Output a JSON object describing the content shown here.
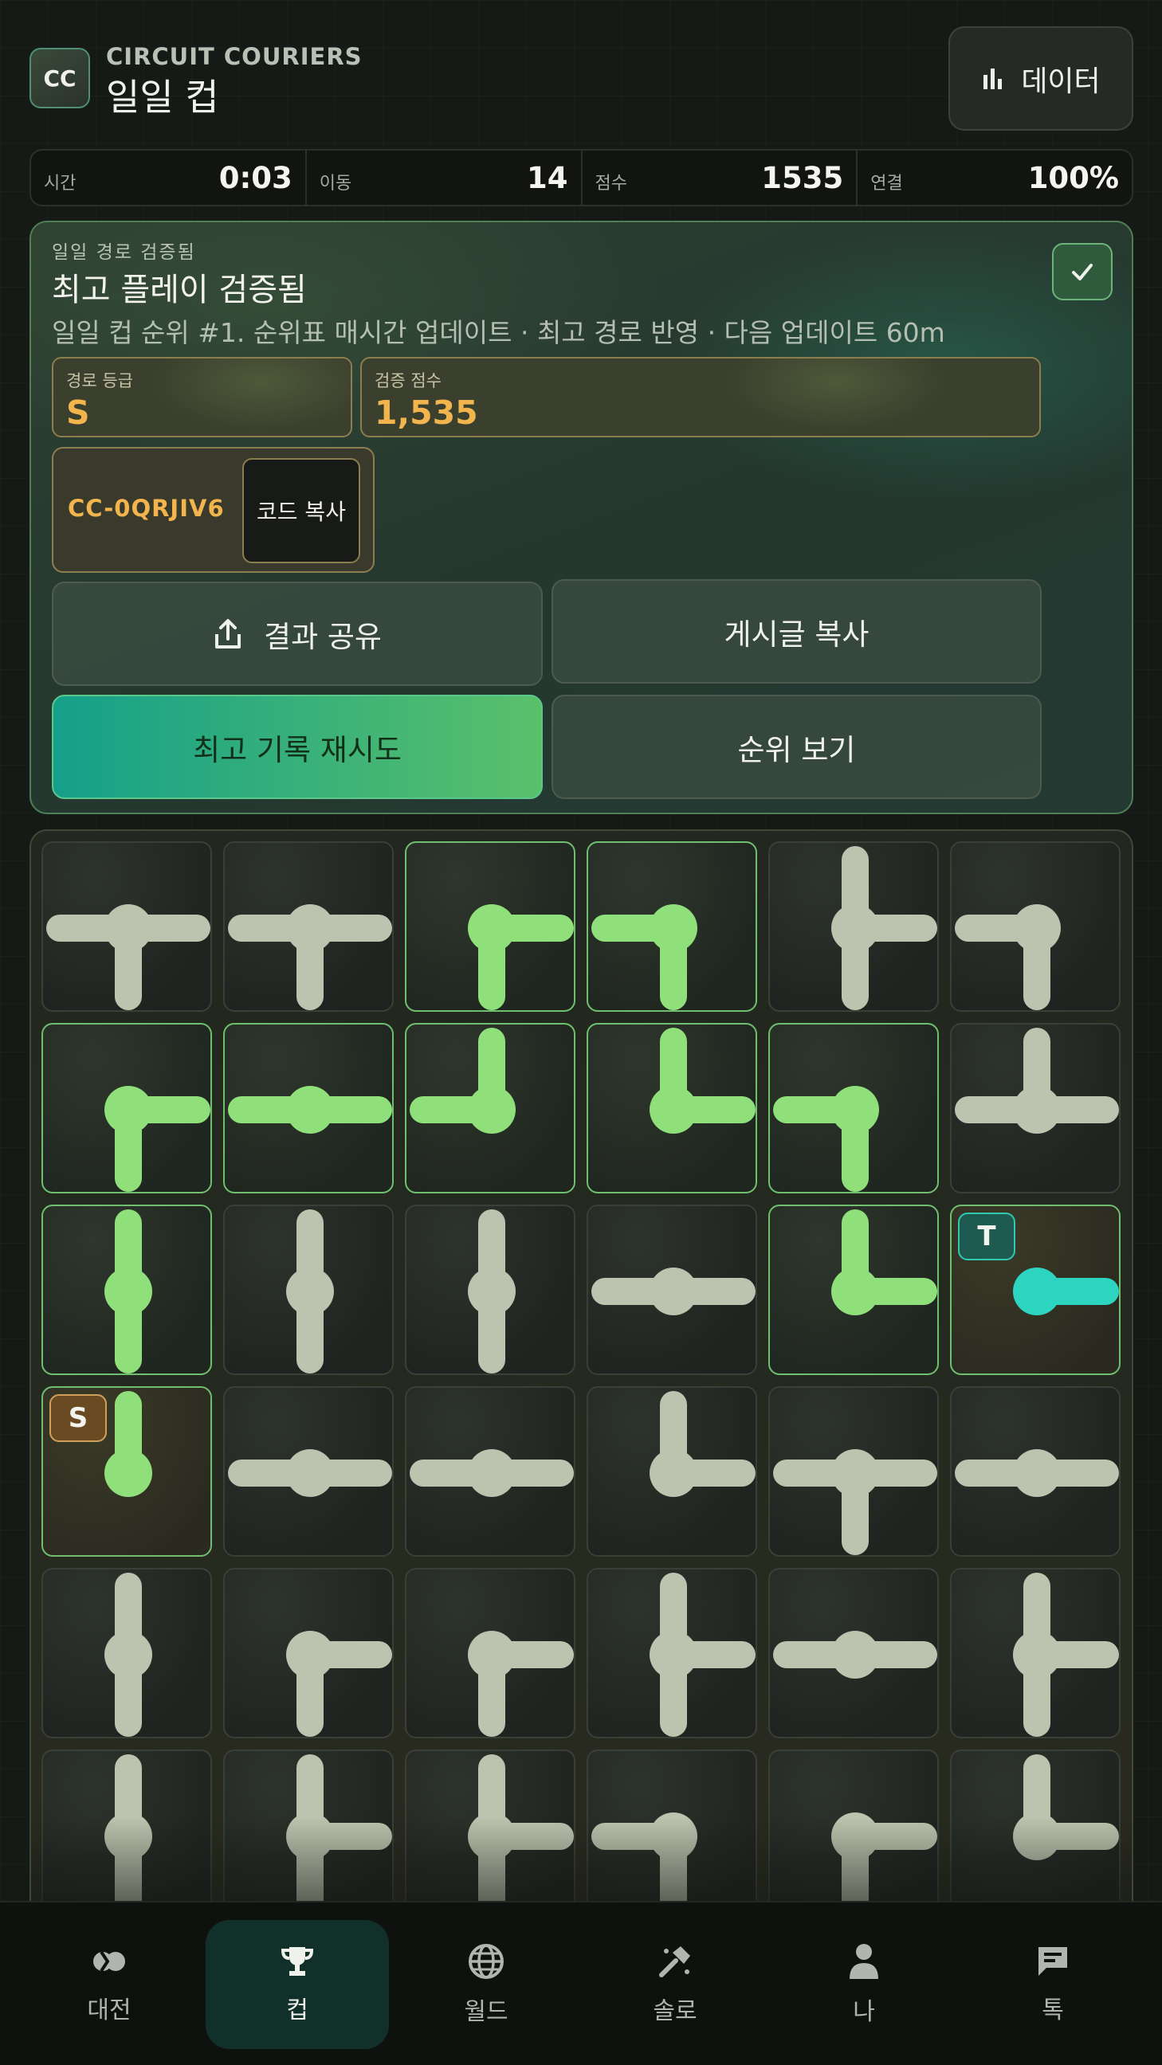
{
  "header": {
    "logo_text": "CC",
    "brand": "CIRCUIT COURIERS",
    "title": "일일 컵",
    "data_button_label": "데이터",
    "data_icon": "bar-chart-icon"
  },
  "stats": [
    {
      "label": "시간",
      "value": "0:03"
    },
    {
      "label": "이동",
      "value": "14"
    },
    {
      "label": "점수",
      "value": "1535"
    },
    {
      "label": "연결",
      "value": "100%"
    }
  ],
  "result": {
    "kicker": "일일 경로 검증됨",
    "heading": "최고 플레이 검증됨",
    "subtitle": "일일 컵 순위 #1. 순위표 매시간 업데이트 · 최고 경로 반영 · 다음 업데이트 60m",
    "grade_label": "경로 등급",
    "grade_value": "S",
    "score_label": "검증 점수",
    "score_value": "1,535",
    "code": "CC-0QRJIV6",
    "copy_code_label": "코드 복사",
    "share_label": "결과 공유",
    "copy_post_label": "게시글 복사",
    "retry_label": "최고 기록 재시도",
    "leaderboard_label": "순위 보기"
  },
  "board": {
    "start_label": "S",
    "target_label": "T",
    "colors": {
      "idle": "#bcc3ae",
      "lit": "#8fe07a",
      "target": "#2dd4bf"
    },
    "tiles": [
      [
        "WES",
        "off"
      ],
      [
        "WES",
        "off"
      ],
      [
        "ES",
        "lit"
      ],
      [
        "WS",
        "lit"
      ],
      [
        "NES",
        "off"
      ],
      [
        "WS",
        "off"
      ],
      [
        "ES",
        "lit"
      ],
      [
        "WE",
        "lit"
      ],
      [
        "NW",
        "lit"
      ],
      [
        "NE",
        "lit"
      ],
      [
        "WS",
        "lit"
      ],
      [
        "NEW",
        "off"
      ],
      [
        "NS",
        "lit"
      ],
      [
        "NS",
        "off"
      ],
      [
        "NS",
        "off"
      ],
      [
        "WE",
        "off"
      ],
      [
        "NE",
        "lit"
      ],
      [
        "E",
        "target"
      ],
      [
        "N",
        "start"
      ],
      [
        "WE",
        "off"
      ],
      [
        "WE",
        "off"
      ],
      [
        "NE",
        "off"
      ],
      [
        "WES",
        "off"
      ],
      [
        "WE",
        "off"
      ],
      [
        "NS",
        "off"
      ],
      [
        "ES",
        "off"
      ],
      [
        "ES",
        "off"
      ],
      [
        "NES",
        "off"
      ],
      [
        "WE",
        "off"
      ],
      [
        "NES",
        "off"
      ],
      [
        "NS",
        "off"
      ],
      [
        "NES",
        "off"
      ],
      [
        "NES",
        "off"
      ],
      [
        "WS",
        "off"
      ],
      [
        "ES",
        "off"
      ],
      [
        "NE",
        "off"
      ]
    ]
  },
  "nav": [
    {
      "label": "대전",
      "icon": "versus-icon",
      "active": false
    },
    {
      "label": "컵",
      "icon": "trophy-icon",
      "active": true
    },
    {
      "label": "월드",
      "icon": "globe-icon",
      "active": false
    },
    {
      "label": "솔로",
      "icon": "hammer-icon",
      "active": false
    },
    {
      "label": "나",
      "icon": "person-icon",
      "active": false
    },
    {
      "label": "톡",
      "icon": "chat-icon",
      "active": false
    }
  ]
}
